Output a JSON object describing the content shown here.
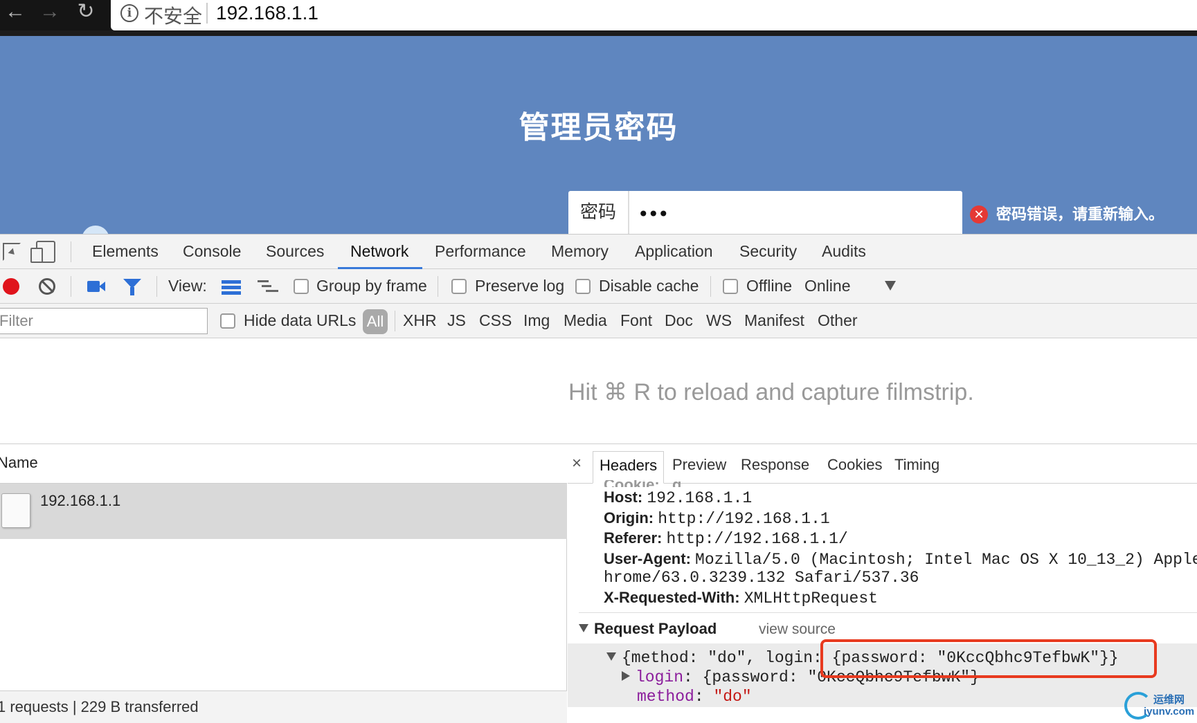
{
  "browser": {
    "back_icon": "←",
    "forward_icon": "→",
    "reload_icon": "↻",
    "info_icon": "i",
    "security_label": "不安全",
    "url": "192.168.1.1"
  },
  "router_page": {
    "title": "管理员密码",
    "password_label": "密码",
    "password_value": "•••",
    "error_icon": "✕",
    "error_message": "密码错误，请重新输入。",
    "colors": {
      "background": "#5f86bf",
      "error": "#e53935"
    }
  },
  "devtools": {
    "tabs": [
      "Elements",
      "Console",
      "Sources",
      "Network",
      "Performance",
      "Memory",
      "Application",
      "Security",
      "Audits"
    ],
    "active_tab": "Network",
    "toolbar": {
      "view_label": "View:",
      "group_by_frame": "Group by frame",
      "preserve_log": "Preserve log",
      "disable_cache": "Disable cache",
      "offline": "Offline",
      "throttling": "Online"
    },
    "filter": {
      "placeholder": "Filter",
      "hide_data_urls": "Hide data URLs",
      "types": [
        "All",
        "XHR",
        "JS",
        "CSS",
        "Img",
        "Media",
        "Font",
        "Doc",
        "WS",
        "Manifest",
        "Other"
      ],
      "active_type": "All"
    },
    "filmstrip_hint": "Hit ⌘ R to reload and capture filmstrip.",
    "request_list": {
      "column_header": "Name",
      "rows": [
        {
          "name": "192.168.1.1"
        }
      ],
      "status": "1 requests | 229 B transferred"
    },
    "details": {
      "close_icon": "×",
      "tabs": [
        "Headers",
        "Preview",
        "Response",
        "Cookies",
        "Timing"
      ],
      "active_tab": "Headers",
      "cookie_partial": "Cookie: _g",
      "headers": [
        {
          "key": "Host:",
          "value": "192.168.1.1"
        },
        {
          "key": "Origin:",
          "value": "http://192.168.1.1"
        },
        {
          "key": "Referer:",
          "value": "http://192.168.1.1/"
        },
        {
          "key": "User-Agent:",
          "value": "Mozilla/5.0 (Macintosh; Intel Mac OS X 10_13_2) Apple",
          "continuation": "hrome/63.0.3239.132 Safari/537.36"
        },
        {
          "key": "X-Requested-With:",
          "value": "XMLHttpRequest"
        }
      ],
      "payload_title": "Request Payload",
      "view_source": "view source",
      "payload_summary": "{method: \"do\", login: {password: \"0KccQbhc9TefbwK\"}}",
      "payload_login_key": "login",
      "payload_login_value": ": {password: \"0KccQbhc9TefbwK\"}",
      "payload_method_key": "method",
      "payload_method_sep": ": ",
      "payload_method_value": "\"do\"",
      "highlight_color": "#e83a1f"
    }
  },
  "watermark": {
    "cn": "运维网",
    "en": "iyunv.com"
  }
}
